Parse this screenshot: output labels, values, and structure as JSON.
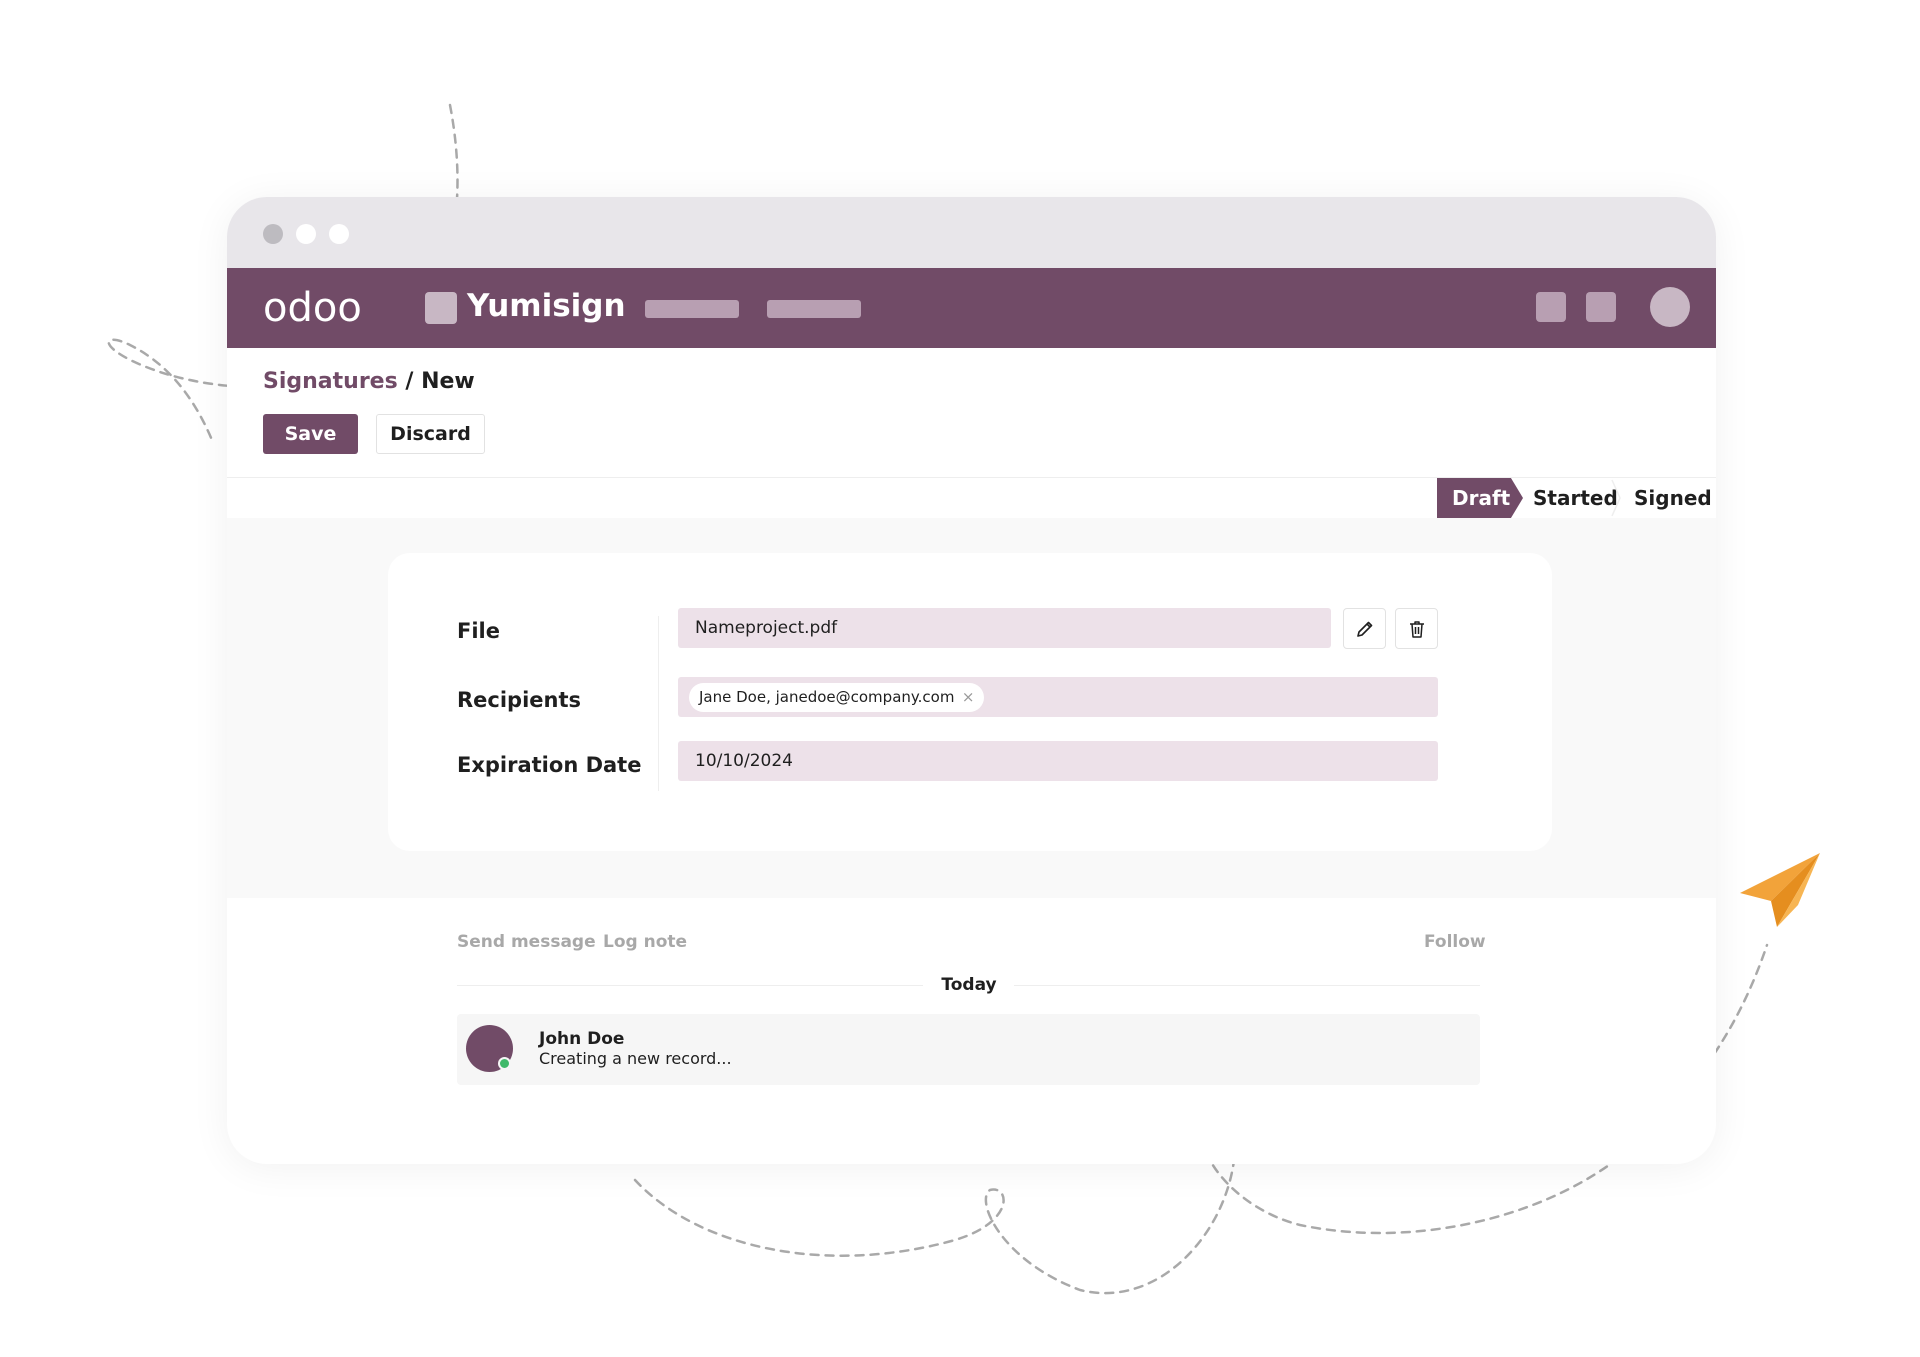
{
  "navbar": {
    "logo_text": "odoo",
    "app_name": "Yumisign",
    "color": "#714b67"
  },
  "breadcrumb": {
    "parent": "Signatures",
    "separator": "/",
    "current": "New"
  },
  "toolbar": {
    "save_label": "Save",
    "discard_label": "Discard"
  },
  "status": {
    "steps": [
      "Draft",
      "Started",
      "Signed"
    ],
    "active": "Draft"
  },
  "form": {
    "file": {
      "label": "File",
      "value": "Nameproject.pdf"
    },
    "recipients": {
      "label": "Recipients",
      "tag": "Jane Doe, janedoe@company.com",
      "tag_remove": "×"
    },
    "expiration": {
      "label": "Expiration Date",
      "value": "10/10/2024"
    }
  },
  "chatter": {
    "send_message": "Send message",
    "log_note": "Log note",
    "follow": "Follow",
    "date_separator": "Today",
    "messages": [
      {
        "author": "John Doe",
        "body": "Creating a new record..."
      }
    ]
  },
  "icons": [
    "pencil-icon",
    "trash-icon",
    "paper-plane-icon"
  ],
  "colors": {
    "accent": "#714b67",
    "input_bg": "#ede1e9",
    "plane": "#f2a33a",
    "online": "#3fb96a"
  }
}
